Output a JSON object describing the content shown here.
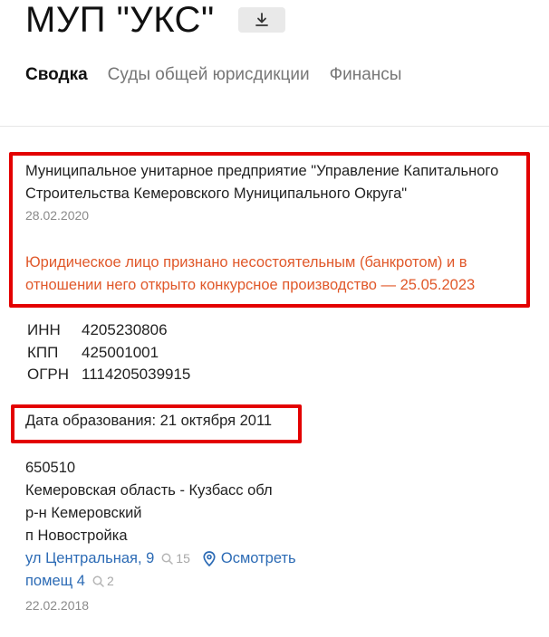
{
  "header": {
    "title": "МУП \"УКС\"",
    "download_icon": "download-icon"
  },
  "tabs": [
    {
      "label": "Сводка",
      "active": true
    },
    {
      "label": "Суды общей юрисдикции",
      "active": false
    },
    {
      "label": "Финансы",
      "active": false
    }
  ],
  "summary": {
    "full_name": "Муниципальное унитарное предприятие \"Управление Капитального Строительства Кемеровского Муниципального Округа\"",
    "name_date": "28.02.2020",
    "status": "Юридическое лицо признано несостоятельным (банкротом) и в отношении него открыто конкурсное производство — 25.05.2023",
    "ids": [
      {
        "key": "ИНН",
        "value": "4205230806"
      },
      {
        "key": "КПП",
        "value": "425001001"
      },
      {
        "key": "ОГРН",
        "value": "1114205039915"
      }
    ],
    "founded": "Дата образования: 21 октября 2011",
    "address": {
      "postcode": "650510",
      "region": "Кемеровская область - Кузбасс обл",
      "district": "р-н Кемеровский",
      "locality": "п Новостройка",
      "street": "ул Центральная, 9",
      "street_count": "15",
      "show_label": "Осмотреть",
      "room": "помещ 4",
      "room_count": "2",
      "date": "22.02.2018"
    }
  },
  "colors": {
    "highlight_border": "#e30000",
    "status_text": "#e0582a",
    "link": "#2c6bb5"
  }
}
